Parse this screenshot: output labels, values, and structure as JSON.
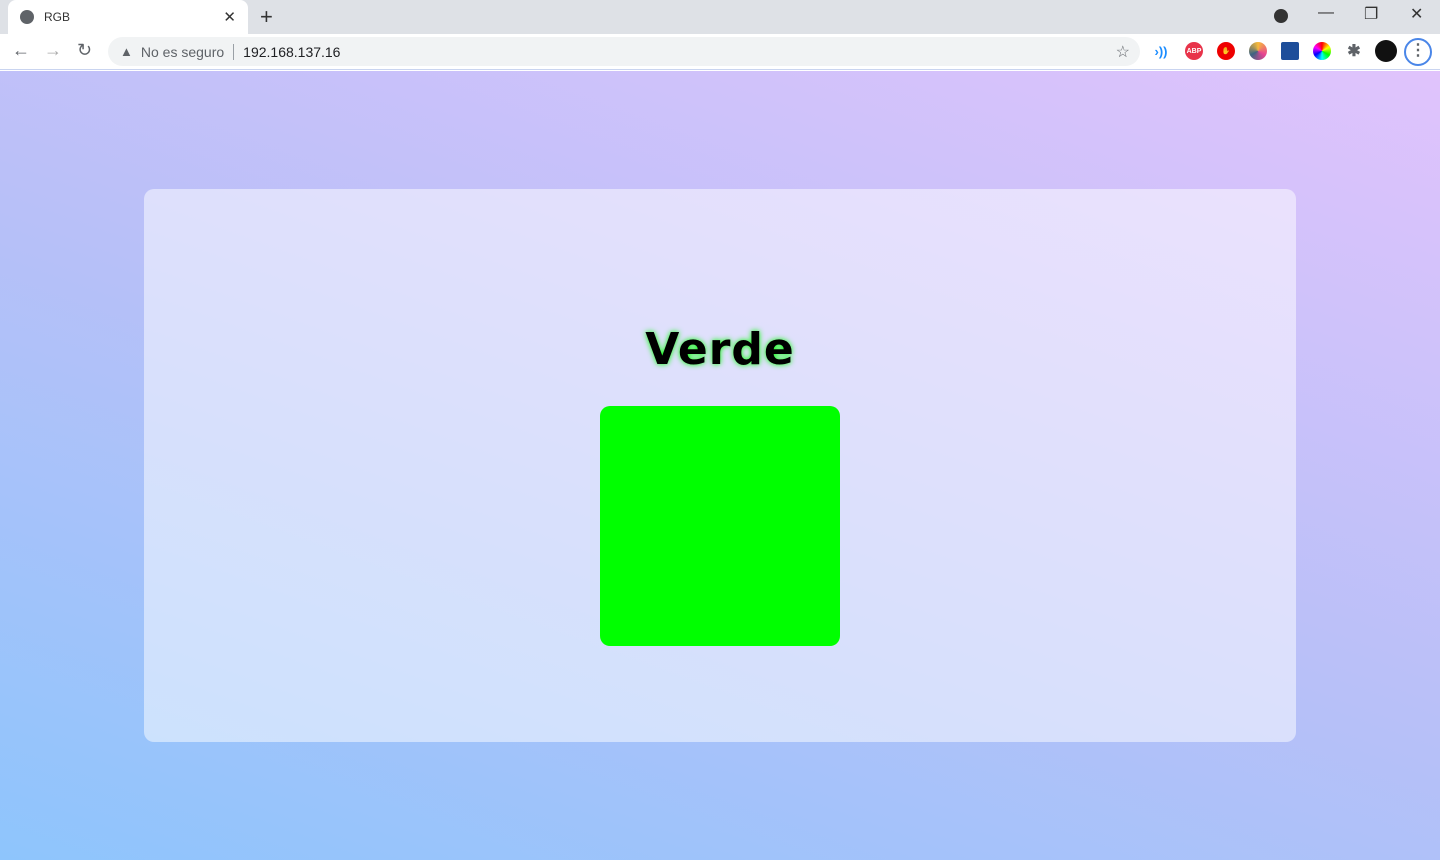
{
  "browser": {
    "tab_title": "RGB",
    "security_label": "No es seguro",
    "url": "192.168.137.16",
    "extensions": [
      "signal-icon",
      "adblock-plus-icon",
      "stop-hand-icon",
      "color-wheel-icon",
      "reader-icon",
      "color-picker-icon",
      "puzzle-icon",
      "avatar"
    ]
  },
  "page": {
    "title": "Verde",
    "swatch_color": "#00ff00",
    "glow_color": "#00ff00"
  }
}
